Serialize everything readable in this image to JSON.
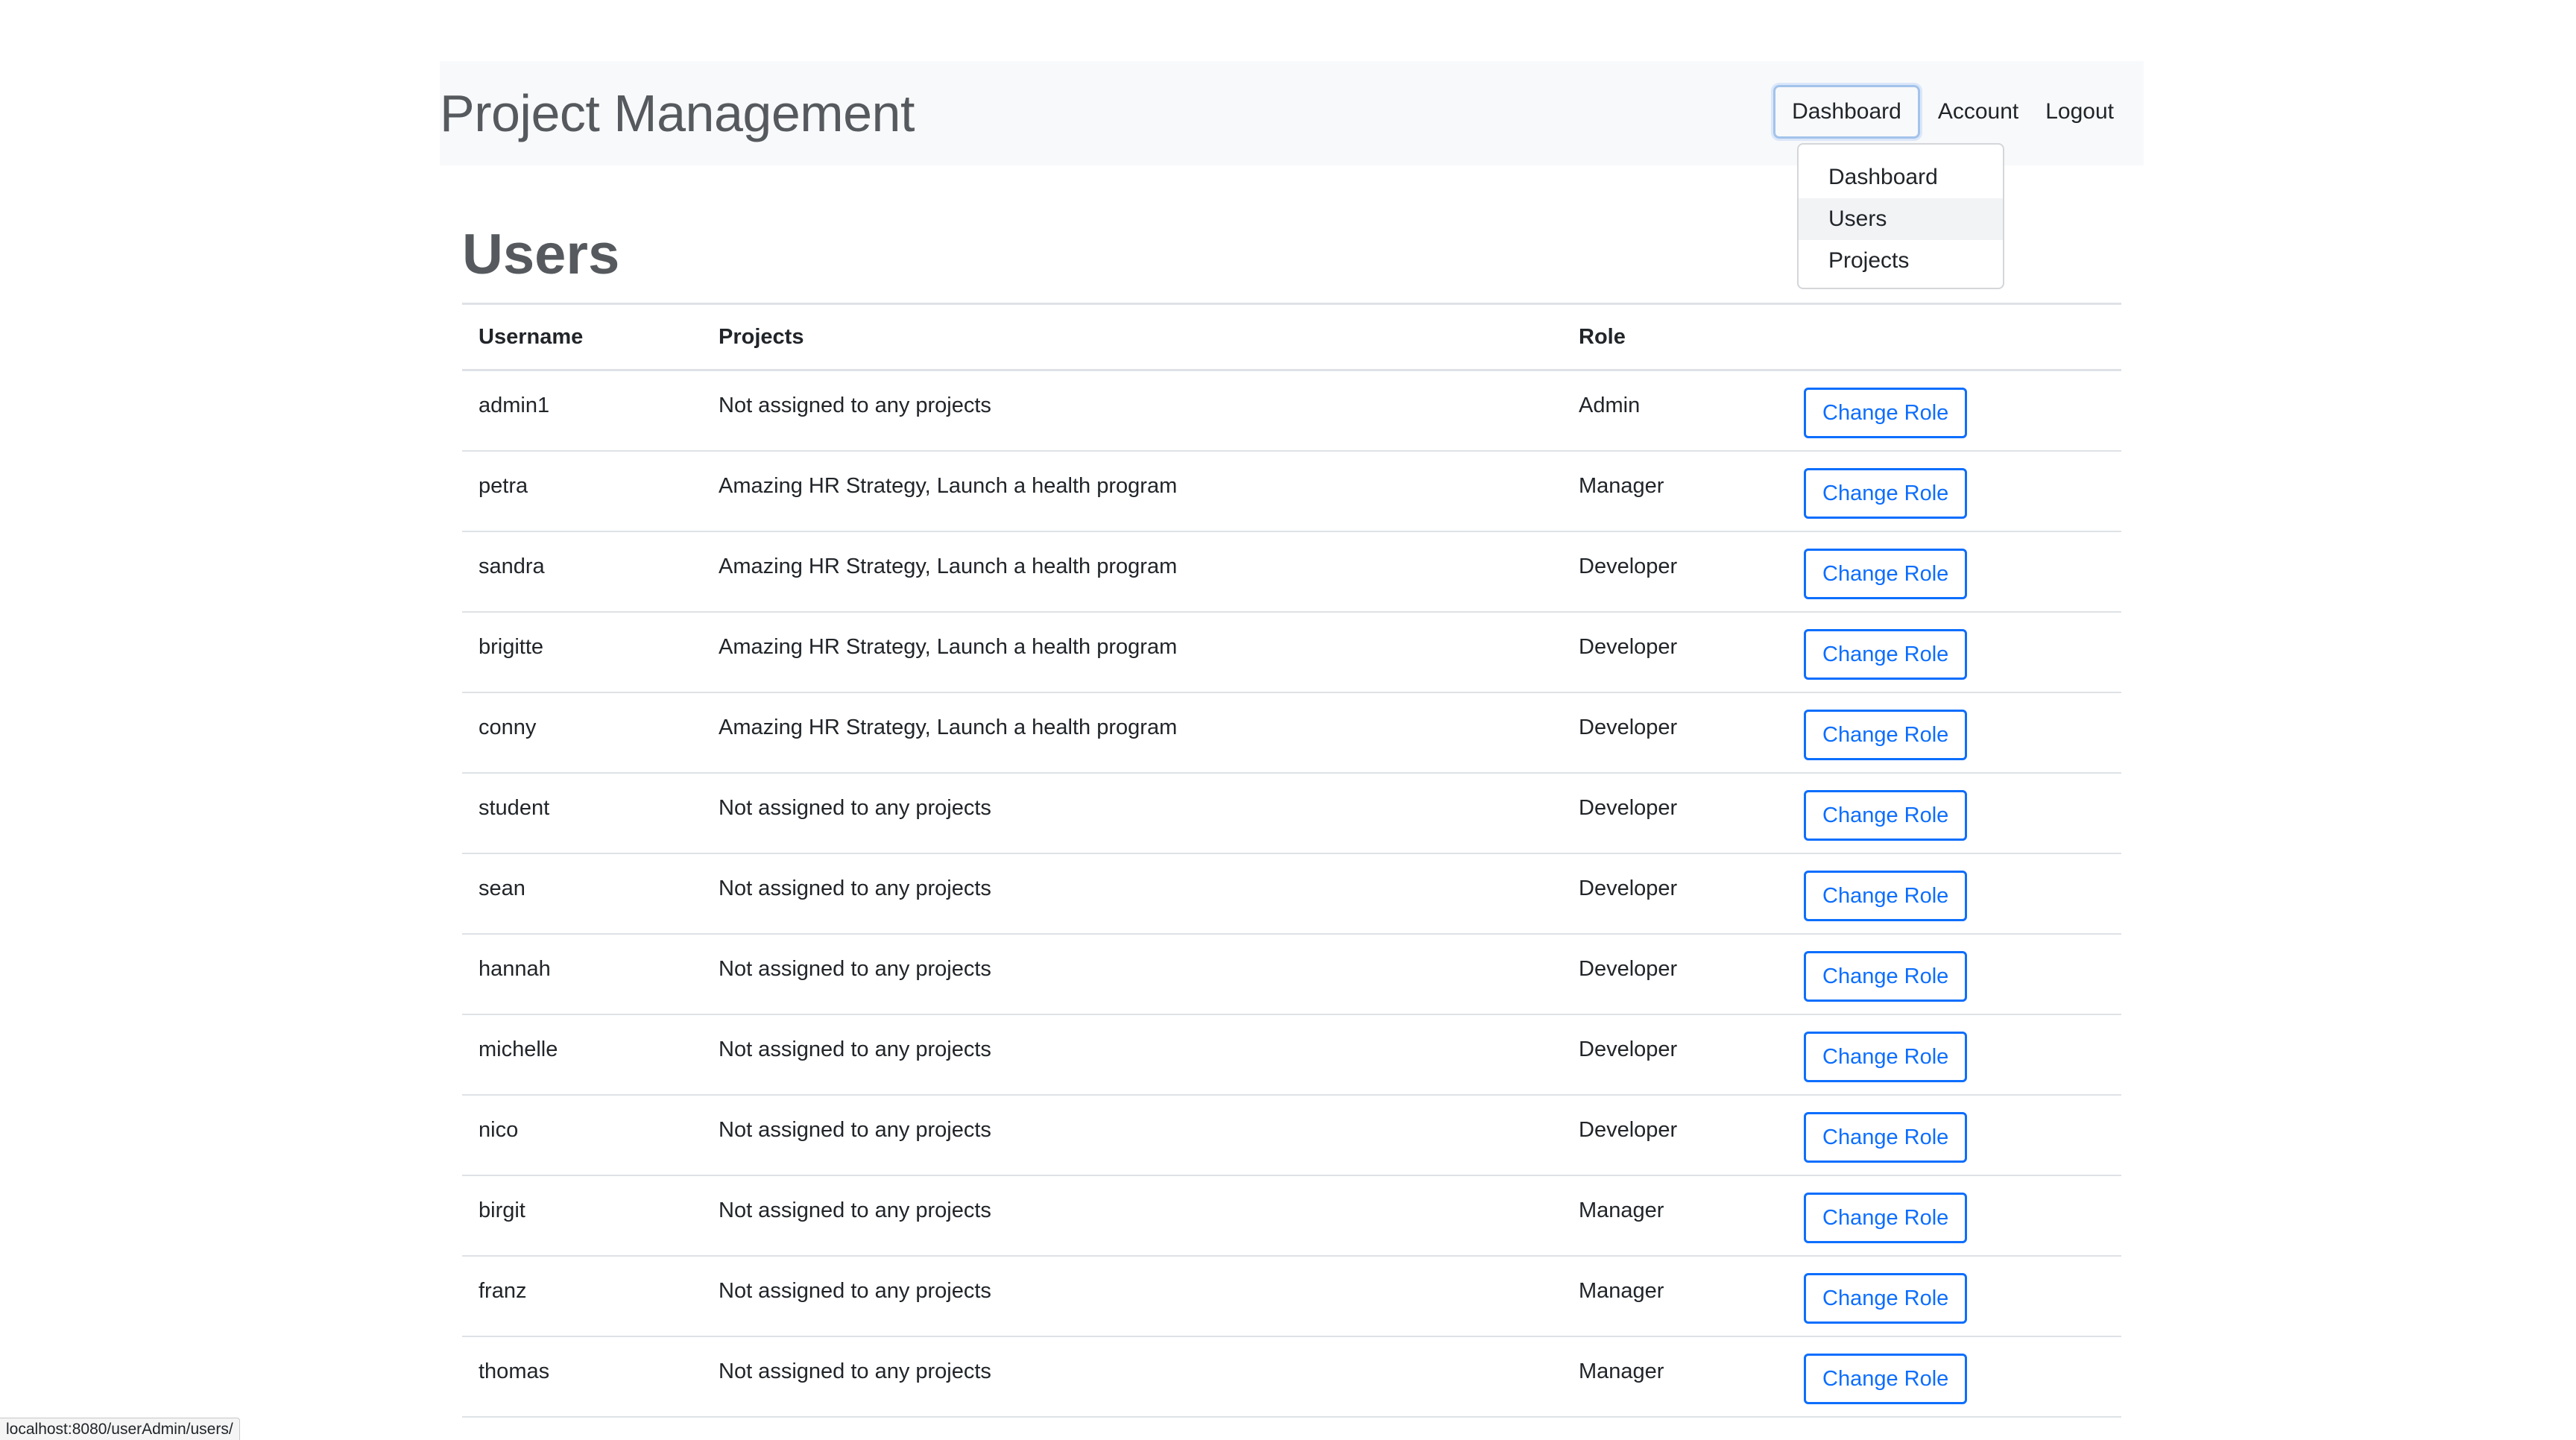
{
  "header": {
    "brand": "Project Management",
    "nav": {
      "dashboard": "Dashboard",
      "account": "Account",
      "logout": "Logout"
    },
    "dropdown": {
      "items": [
        "Dashboard",
        "Users",
        "Projects"
      ]
    }
  },
  "main": {
    "title": "Users",
    "table": {
      "headers": {
        "username": "Username",
        "projects": "Projects",
        "role": "Role"
      },
      "rows": [
        {
          "username": "admin1",
          "projects": "Not assigned to any projects",
          "role": "Admin",
          "action": "Change Role"
        },
        {
          "username": "petra",
          "projects": "Amazing HR Strategy, Launch a health program",
          "role": "Manager",
          "action": "Change Role"
        },
        {
          "username": "sandra",
          "projects": "Amazing HR Strategy, Launch a health program",
          "role": "Developer",
          "action": "Change Role"
        },
        {
          "username": "brigitte",
          "projects": "Amazing HR Strategy, Launch a health program",
          "role": "Developer",
          "action": "Change Role"
        },
        {
          "username": "conny",
          "projects": "Amazing HR Strategy, Launch a health program",
          "role": "Developer",
          "action": "Change Role"
        },
        {
          "username": "student",
          "projects": "Not assigned to any projects",
          "role": "Developer",
          "action": "Change Role"
        },
        {
          "username": "sean",
          "projects": "Not assigned to any projects",
          "role": "Developer",
          "action": "Change Role"
        },
        {
          "username": "hannah",
          "projects": "Not assigned to any projects",
          "role": "Developer",
          "action": "Change Role"
        },
        {
          "username": "michelle",
          "projects": "Not assigned to any projects",
          "role": "Developer",
          "action": "Change Role"
        },
        {
          "username": "nico",
          "projects": "Not assigned to any projects",
          "role": "Developer",
          "action": "Change Role"
        },
        {
          "username": "birgit",
          "projects": "Not assigned to any projects",
          "role": "Manager",
          "action": "Change Role"
        },
        {
          "username": "franz",
          "projects": "Not assigned to any projects",
          "role": "Manager",
          "action": "Change Role"
        },
        {
          "username": "thomas",
          "projects": "Not assigned to any projects",
          "role": "Manager",
          "action": "Change Role"
        }
      ]
    }
  },
  "statusbar": {
    "url": "localhost:8080/userAdmin/users/"
  },
  "colors": {
    "primary": "#0d6efd",
    "navbar_bg": "#f8f9fa",
    "border": "#dee2e6"
  }
}
